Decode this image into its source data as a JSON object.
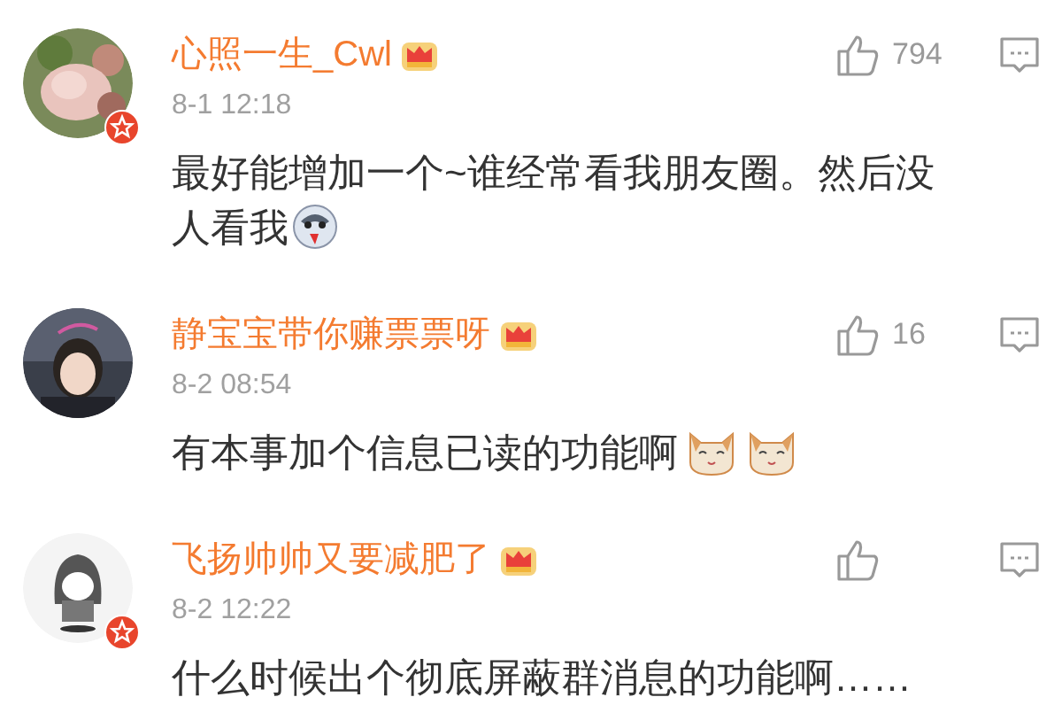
{
  "comments": [
    {
      "name": "心照一生_Cwl",
      "verified": true,
      "time": "8-1 12:18",
      "likes": "794",
      "text": "最好能增加一个~谁经常看我朋友圈。然后没人看我",
      "emojis": [
        {
          "kind": "husky"
        }
      ]
    },
    {
      "name": "静宝宝带你赚票票呀",
      "verified": false,
      "time": "8-2 08:54",
      "likes": "16",
      "text": "有本事加个信息已读的功能啊",
      "emojis": [
        {
          "kind": "cat"
        },
        {
          "kind": "cat"
        }
      ]
    },
    {
      "name": "飞扬帅帅又要减肥了",
      "verified": true,
      "time": "8-2 12:22",
      "text": "什么时候出个彻底屏蔽群消息的功能啊……"
    }
  ]
}
